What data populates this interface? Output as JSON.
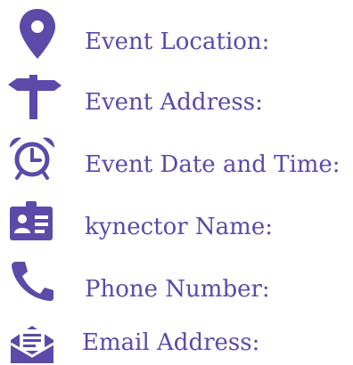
{
  "colors": {
    "accent": "#5b4aa8",
    "icon": "#5b4aa8"
  },
  "fields": [
    {
      "icon": "map-pin-icon",
      "label": "Event Location:"
    },
    {
      "icon": "signpost-icon",
      "label": "Event Address:"
    },
    {
      "icon": "alarm-clock-icon",
      "label": "Event Date and Time:"
    },
    {
      "icon": "id-card-icon",
      "label": "kynector Name:"
    },
    {
      "icon": "phone-icon",
      "label": "Phone Number:"
    },
    {
      "icon": "mail-icon",
      "label": "Email Address:"
    }
  ]
}
